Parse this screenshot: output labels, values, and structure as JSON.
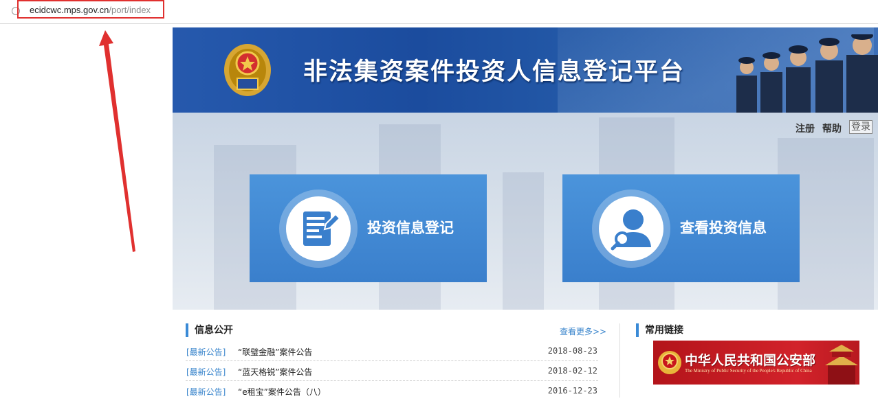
{
  "browser": {
    "url_host": "ecidcwc.mps.gov.cn",
    "url_path": "/port/index"
  },
  "banner": {
    "title": "非法集资案件投资人信息登记平台"
  },
  "toplinks": {
    "register": "注册",
    "help": "帮助",
    "login": "登录"
  },
  "actions": {
    "register_label": "投资信息登记",
    "view_label": "查看投资信息"
  },
  "info": {
    "title": "信息公开",
    "more": "查看更多>>",
    "items": [
      {
        "tag": "[最新公告]",
        "title": "“联璧金融”案件公告",
        "date": "2018-08-23"
      },
      {
        "tag": "[最新公告]",
        "title": "“蓝天格锐”案件公告",
        "date": "2018-02-12"
      },
      {
        "tag": "[最新公告]",
        "title": "“e租宝”案件公告（八）",
        "date": "2016-12-23"
      }
    ]
  },
  "links": {
    "title": "常用链接",
    "mps_cn": "中华人民共和国公安部",
    "mps_en": "The Ministry of Public Security of the People's Republic of China"
  },
  "colors": {
    "accent": "#3a8ad6",
    "highlight": "#e0302f",
    "banner_blue": "#1b4c9e"
  }
}
